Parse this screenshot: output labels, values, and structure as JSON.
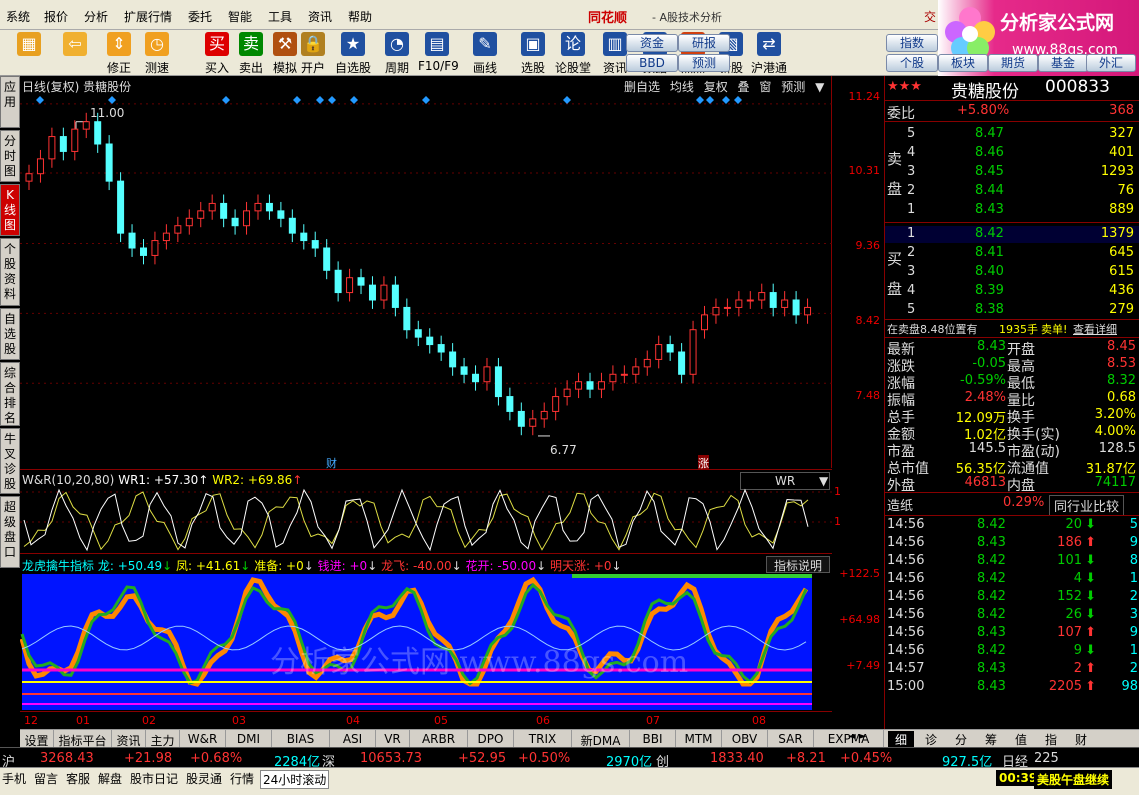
{
  "menu": [
    "系统",
    "报价",
    "分析",
    "扩展行情",
    "委托",
    "智能",
    "工具",
    "资讯",
    "帮助"
  ],
  "brand": {
    "name": "同花顺",
    "subtitle": "- A股技术分析",
    "extra": "交"
  },
  "logo": {
    "title": "分析家公式网",
    "url": "www.88gs.com"
  },
  "toolbar": [
    {
      "label": "",
      "icon": "windows-icon",
      "color": "#e8a020"
    },
    {
      "label": "",
      "icon": "back-arrow-icon",
      "color": "#f0b030"
    },
    {
      "label": "修正",
      "icon": "up-down-arrows-icon",
      "color": "#f0a020"
    },
    {
      "label": "测速",
      "icon": "clock-icon",
      "color": "#f0a020"
    },
    {
      "label": "买入",
      "icon": "buy-icon",
      "glyph": "买",
      "color": "#d00"
    },
    {
      "label": "卖出",
      "icon": "sell-icon",
      "glyph": "卖",
      "color": "#080"
    },
    {
      "label": "模拟",
      "icon": "hammer-icon",
      "color": "#b05010"
    },
    {
      "label": "开户",
      "icon": "lock-icon",
      "color": "#b08020"
    },
    {
      "label": "自选股",
      "icon": "star-icon",
      "color": "#2050a0"
    },
    {
      "label": "周期",
      "icon": "cycle-icon",
      "color": "#2050a0"
    },
    {
      "label": "F10/F9",
      "icon": "document-icon",
      "color": "#2050a0"
    },
    {
      "label": "画线",
      "icon": "pencil-icon",
      "color": "#2050a0"
    },
    {
      "label": "选股",
      "icon": "screen-icon",
      "color": "#2050a0"
    },
    {
      "label": "论股堂",
      "icon": "forum-icon",
      "glyph": "论",
      "color": "#2050a0"
    },
    {
      "label": "资讯",
      "icon": "news-icon",
      "color": "#2050a0"
    },
    {
      "label": "数据",
      "icon": "pe-icon",
      "glyph": "PE",
      "color": "#2050a0"
    },
    {
      "label": "热点",
      "icon": "hot-icon",
      "color": "#d04010"
    },
    {
      "label": "新股",
      "icon": "new-stock-icon",
      "color": "#2050a0"
    },
    {
      "label": "沪港通",
      "icon": "sse-hkex-icon",
      "color": "#2050a0"
    }
  ],
  "toolbar_pills": [
    "资金",
    "研报",
    "BBD",
    "预测",
    "指数",
    "个股",
    "板块",
    "期货",
    "基金",
    "外汇"
  ],
  "sidetabs": [
    "应用",
    "分时图",
    "K线图",
    "个股资料",
    "自选股",
    "综合排名",
    "牛叉诊股",
    "超级盘口"
  ],
  "chart": {
    "title": "日线(复权) 贵糖股份",
    "buttons": [
      "删自选",
      "均线",
      "复权",
      "叠",
      "窗",
      "预测"
    ],
    "high_label": "11.00",
    "low_label": "6.77",
    "marker_fin": "财",
    "marker_up": "涨",
    "yticks": [
      "11.24",
      "10.31",
      "9.36",
      "8.42",
      "7.48"
    ]
  },
  "chart_data": [
    {
      "type": "candlestick",
      "title": "日线(复权) 贵糖股份",
      "ylim": [
        6.5,
        11.4
      ],
      "y_ticks": [
        11.24,
        10.31,
        9.36,
        8.42,
        7.48
      ],
      "x_ticks": [
        "12",
        "01",
        "02",
        "03",
        "04",
        "05",
        "06",
        "07",
        "08"
      ],
      "high": 11.0,
      "low": 6.77,
      "close_series": [
        10.3,
        10.5,
        10.8,
        10.6,
        10.9,
        11.0,
        10.7,
        10.2,
        9.5,
        9.3,
        9.2,
        9.4,
        9.5,
        9.6,
        9.7,
        9.8,
        9.9,
        9.7,
        9.6,
        9.8,
        9.9,
        9.8,
        9.7,
        9.5,
        9.4,
        9.3,
        9.0,
        8.7,
        8.9,
        8.8,
        8.6,
        8.8,
        8.5,
        8.2,
        8.1,
        8.0,
        7.9,
        7.7,
        7.6,
        7.5,
        7.7,
        7.3,
        7.1,
        6.9,
        7.0,
        7.1,
        7.3,
        7.4,
        7.5,
        7.4,
        7.5,
        7.6,
        7.6,
        7.7,
        7.8,
        8.0,
        7.9,
        7.6,
        8.2,
        8.4,
        8.5,
        8.5,
        8.6,
        8.6,
        8.7,
        8.5,
        8.6,
        8.4,
        8.5
      ]
    },
    {
      "type": "line",
      "title": "W&R(10,20,80)",
      "series": [
        {
          "name": "WR1",
          "last": 57.3
        },
        {
          "name": "WR2",
          "last": 69.86
        }
      ],
      "y_ticks": [
        1,
        1
      ]
    },
    {
      "type": "area",
      "title": "龙虎擒牛指标",
      "series": [
        {
          "name": "龙",
          "last": 50.49
        },
        {
          "name": "凤",
          "last": 41.61
        },
        {
          "name": "准备",
          "last": 0
        },
        {
          "name": "钱进",
          "last": 0
        },
        {
          "name": "龙飞",
          "last": -40.0
        },
        {
          "name": "花开",
          "last": -50.0
        },
        {
          "name": "明天涨",
          "last": 0
        }
      ],
      "y_ticks": [
        122.5,
        64.98,
        7.49
      ]
    }
  ],
  "wr": {
    "label": "W&R(10,20,80)",
    "wr1": "WR1: +57.30",
    "wr2": "WR2: +69.86",
    "tab": "WR",
    "yticks": [
      "1",
      "1"
    ]
  },
  "dragon": {
    "label": "龙虎擒牛指标",
    "long": "龙: +50.49",
    "feng": "凤: +41.61",
    "prep": "准备: +0",
    "money": "钱进: +0",
    "fly": "龙飞: -40.00",
    "bloom": "花开: -50.00",
    "tomorrow": "明天涨: +0",
    "help": "指标说明",
    "yticks": [
      "+122.5",
      "+64.98",
      "+7.49"
    ]
  },
  "xaxis": [
    "12",
    "01",
    "02",
    "03",
    "04",
    "05",
    "06",
    "07",
    "08"
  ],
  "bottomtabs": [
    "设置",
    "指标平台",
    "资讯",
    "主力",
    "W&R",
    "DMI",
    "BIAS",
    "ASI",
    "VR",
    "ARBR",
    "DPO",
    "TRIX",
    "新DMA",
    "BBI",
    "MTM",
    "OBV",
    "SAR",
    "EXPMA",
    "龙虎擒牛指标"
  ],
  "righttabs": [
    "细",
    "诊",
    "分",
    "筹",
    "值",
    "指",
    "财"
  ],
  "stock": {
    "name": "贵糖股份",
    "code": "000833",
    "stars": "★★★"
  },
  "weibi": {
    "label": "委比",
    "pct": "+5.80%",
    "diff": "368"
  },
  "sell_label": "卖盘",
  "buy_label": "买盘",
  "sell": [
    {
      "n": "5",
      "p": "8.47",
      "v": "327"
    },
    {
      "n": "4",
      "p": "8.46",
      "v": "401"
    },
    {
      "n": "3",
      "p": "8.45",
      "v": "1293"
    },
    {
      "n": "2",
      "p": "8.44",
      "v": "76"
    },
    {
      "n": "1",
      "p": "8.43",
      "v": "889"
    }
  ],
  "buy": [
    {
      "n": "1",
      "p": "8.42",
      "v": "1379"
    },
    {
      "n": "2",
      "p": "8.41",
      "v": "645"
    },
    {
      "n": "3",
      "p": "8.40",
      "v": "615"
    },
    {
      "n": "4",
      "p": "8.39",
      "v": "436"
    },
    {
      "n": "5",
      "p": "8.38",
      "v": "279"
    }
  ],
  "notice": {
    "text": "在卖盘8.48位置有",
    "qty": "1935手",
    "flag": "卖单!",
    "link": "查看详细"
  },
  "quote": [
    {
      "l": "最新",
      "v": "8.43",
      "l2": "开盘",
      "v2": "8.45"
    },
    {
      "l": "涨跌",
      "v": "-0.05",
      "l2": "最高",
      "v2": "8.53"
    },
    {
      "l": "涨幅",
      "v": "-0.59%",
      "l2": "最低",
      "v2": "8.32"
    },
    {
      "l": "振幅",
      "v": "2.48%",
      "l2": "量比",
      "v2": "0.68"
    },
    {
      "l": "总手",
      "v": "12.09万",
      "l2": "换手",
      "v2": "3.20%"
    },
    {
      "l": "金额",
      "v": "1.02亿",
      "l2": "换手(实)",
      "v2": "4.00%"
    },
    {
      "l": "市盈",
      "v": "145.5",
      "l2": "市盈(动)",
      "v2": "128.5"
    },
    {
      "l": "总市值",
      "v": "56.35亿",
      "l2": "流通值",
      "v2": "31.87亿"
    },
    {
      "l": "外盘",
      "v": "46813",
      "l2": "内盘",
      "v2": "74117"
    }
  ],
  "industry": {
    "name": "造纸",
    "pct": "0.29%",
    "btn": "同行业比较"
  },
  "ticks": [
    {
      "t": "14:56",
      "p": "8.42",
      "v": "20",
      "d": "down",
      "n": "5"
    },
    {
      "t": "14:56",
      "p": "8.43",
      "v": "186",
      "d": "up",
      "n": "9"
    },
    {
      "t": "14:56",
      "p": "8.42",
      "v": "101",
      "d": "down",
      "n": "8"
    },
    {
      "t": "14:56",
      "p": "8.42",
      "v": "4",
      "d": "down",
      "n": "1"
    },
    {
      "t": "14:56",
      "p": "8.42",
      "v": "152",
      "d": "down",
      "n": "2"
    },
    {
      "t": "14:56",
      "p": "8.42",
      "v": "26",
      "d": "down",
      "n": "3"
    },
    {
      "t": "14:56",
      "p": "8.43",
      "v": "107",
      "d": "up",
      "n": "9"
    },
    {
      "t": "14:56",
      "p": "8.42",
      "v": "9",
      "d": "down",
      "n": "1"
    },
    {
      "t": "14:57",
      "p": "8.43",
      "v": "2",
      "d": "up",
      "n": "2"
    },
    {
      "t": "15:00",
      "p": "8.43",
      "v": "2205",
      "d": "up",
      "n": "98"
    }
  ],
  "indexbar": {
    "sh": "沪",
    "sh_v": "3268.43",
    "sh_c": "+21.98",
    "sh_p": "+0.68%",
    "sh_a": "2284亿",
    "sz": "深",
    "sz_v": "10653.73",
    "sz_c": "+52.95",
    "sz_p": "+0.50%",
    "sz_a": "2970亿",
    "cy": "创",
    "cy_v": "1833.40",
    "cy_c": "+8.21",
    "cy_p": "+0.45%",
    "cy_a": "927.5亿",
    "rj": "日经",
    "rj_v": "225"
  },
  "statusbar": [
    "手机",
    "留言",
    "客服",
    "解盘",
    "股市日记",
    "股灵通",
    "行情",
    "24小时滚动"
  ],
  "statusbar_right": {
    "time": "00:39",
    "text": "美股午盘继续"
  }
}
